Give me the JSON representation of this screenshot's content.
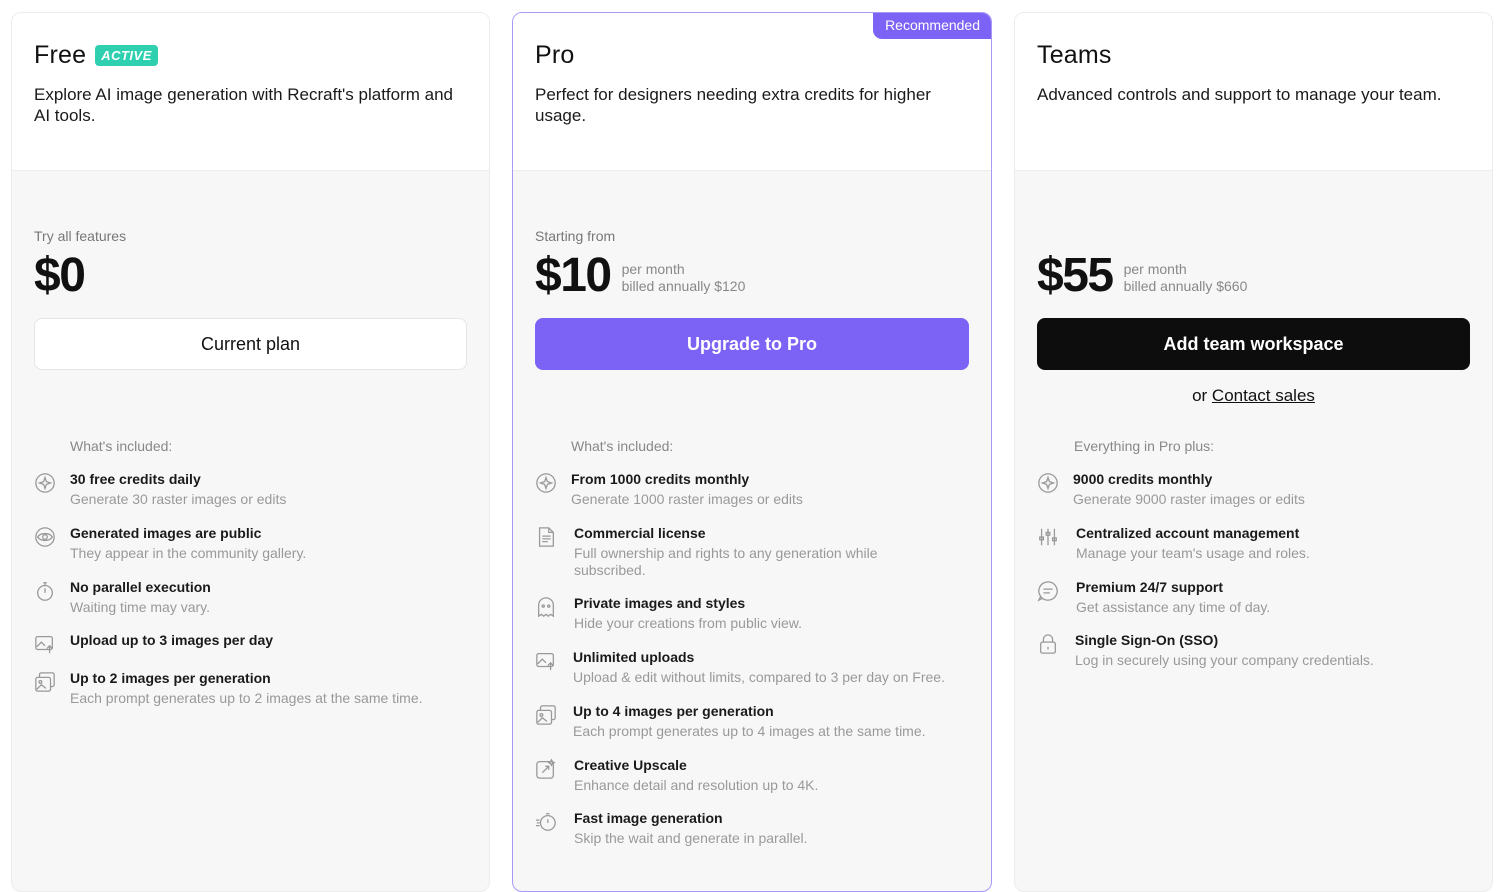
{
  "plans": [
    {
      "name": "Free",
      "badge": "ACTIVE",
      "description": "Explore AI image generation with Recraft's platform and AI tools.",
      "price_label": "Try all features",
      "price": "$0",
      "price_note_1": "",
      "price_note_2": "",
      "button": "Current plan",
      "included_label": "What's included:",
      "features": [
        {
          "icon": "sparkle-icon",
          "title": "30 free credits daily",
          "sub": "Generate 30 raster images or edits"
        },
        {
          "icon": "eye-icon",
          "title": "Generated images are public",
          "sub": "They appear in the community gallery."
        },
        {
          "icon": "stopwatch-icon",
          "title": "No parallel execution",
          "sub": "Waiting time may vary."
        },
        {
          "icon": "upload-image-icon",
          "title": "Upload up to 3 images per day",
          "sub": ""
        },
        {
          "icon": "images-icon",
          "title": "Up to 2 images per generation",
          "sub": "Each prompt generates up to 2 images at the same time."
        }
      ]
    },
    {
      "name": "Pro",
      "ribbon": "Recommended",
      "description": "Perfect for designers needing extra credits for higher usage.",
      "price_label": "Starting from",
      "price": "$10",
      "price_note_1": "per month",
      "price_note_2": "billed annually $120",
      "button": "Upgrade to Pro",
      "included_label": "What's included:",
      "features": [
        {
          "icon": "sparkle-icon",
          "title": "From 1000 credits monthly",
          "sub": "Generate 1000 raster images or edits"
        },
        {
          "icon": "document-icon",
          "title": "Commercial license",
          "sub": "Full ownership and rights to any generation while subscribed."
        },
        {
          "icon": "ghost-icon",
          "title": "Private images and styles",
          "sub": "Hide your creations from public view."
        },
        {
          "icon": "upload-image-icon",
          "title": "Unlimited uploads",
          "sub": "Upload & edit without limits, compared to 3 per day on Free."
        },
        {
          "icon": "images-icon",
          "title": "Up to 4 images per generation",
          "sub": "Each prompt generates up to 4 images at the same time."
        },
        {
          "icon": "upscale-icon",
          "title": "Creative Upscale",
          "sub": "Enhance detail and resolution up to 4K."
        },
        {
          "icon": "fast-timer-icon",
          "title": "Fast image generation",
          "sub": "Skip the wait and generate in parallel."
        }
      ]
    },
    {
      "name": "Teams",
      "description": "Advanced controls and support to manage your team.",
      "price_label": "",
      "price": "$55",
      "price_note_1": "per month",
      "price_note_2": "billed annually $660",
      "button": "Add team workspace",
      "contact_prefix": "or",
      "contact_link": "Contact sales",
      "included_label": "Everything in Pro plus:",
      "features": [
        {
          "icon": "sparkle-icon",
          "title": "9000 credits monthly",
          "sub": "Generate 9000 raster images or edits"
        },
        {
          "icon": "sliders-icon",
          "title": "Centralized account management",
          "sub": "Manage your team's usage and roles."
        },
        {
          "icon": "chat-icon",
          "title": "Premium 24/7 support",
          "sub": "Get assistance any time of day."
        },
        {
          "icon": "lock-icon",
          "title": "Single Sign-On (SSO)",
          "sub": "Log in securely using your company credentials."
        }
      ]
    }
  ],
  "colors": {
    "accent": "#7d63f5",
    "active_badge": "#2fd0b0",
    "team_button": "#0d0d0d"
  }
}
